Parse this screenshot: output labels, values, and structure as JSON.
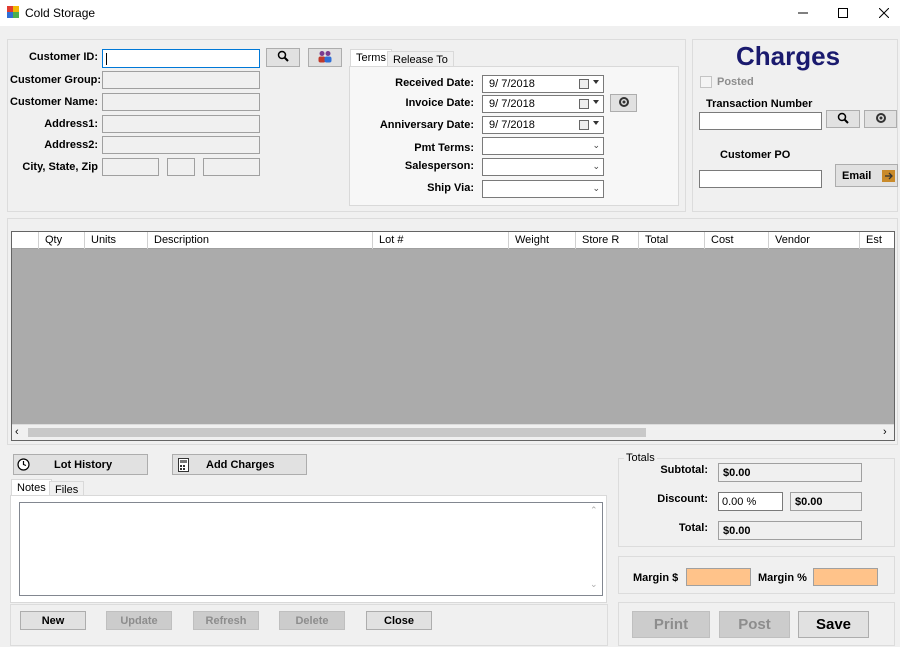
{
  "window": {
    "title": "Cold Storage"
  },
  "customer": {
    "labels": {
      "customer_id": "Customer ID:",
      "customer_group": "Customer Group:",
      "customer_name": "Customer Name:",
      "address1": "Address1:",
      "address2": "Address2:",
      "city_state_zip": "City, State, Zip"
    }
  },
  "terms": {
    "tabs": [
      "Terms",
      "Release To"
    ],
    "received_date_label": "Received Date:",
    "received_date": "9/ 7/2018",
    "invoice_date_label": "Invoice Date:",
    "invoice_date": "9/ 7/2018",
    "anniversary_date_label": "Anniversary  Date:",
    "anniversary_date": "9/ 7/2018",
    "pmt_terms_label": "Pmt Terms:",
    "salesperson_label": "Salesperson:",
    "ship_via_label": "Ship Via:"
  },
  "charges": {
    "title": "Charges",
    "posted_label": "Posted",
    "transaction_number_label": "Transaction Number",
    "customer_po_label": "Customer PO",
    "email_label": "Email"
  },
  "grid": {
    "columns": [
      "Qty",
      "Units",
      "Description",
      "Lot #",
      "Weight",
      "Store R",
      "Total",
      "Cost",
      "Vendor",
      "Est"
    ]
  },
  "actions": {
    "lot_history": "Lot History",
    "add_charges": "Add Charges"
  },
  "notes": {
    "tabs": [
      "Notes",
      "Files"
    ]
  },
  "bottom_buttons": {
    "new": "New",
    "update": "Update",
    "refresh": "Refresh",
    "delete": "Delete",
    "close": "Close"
  },
  "totals": {
    "title": "Totals",
    "subtotal_label": "Subtotal:",
    "subtotal": "$0.00",
    "discount_label": "Discount:",
    "discount_pct": "0.00 %",
    "discount_amt": "$0.00",
    "total_label": "Total:",
    "total": "$0.00"
  },
  "margin": {
    "dollar_label": "Margin $",
    "pct_label": "Margin %"
  },
  "final_buttons": {
    "print": "Print",
    "post": "Post",
    "save": "Save"
  },
  "colors": {
    "accent": "#0078d7",
    "margin_fill": "#ffc38a",
    "grid_bg": "#ababab",
    "charges_title": "#1a1a6e"
  }
}
